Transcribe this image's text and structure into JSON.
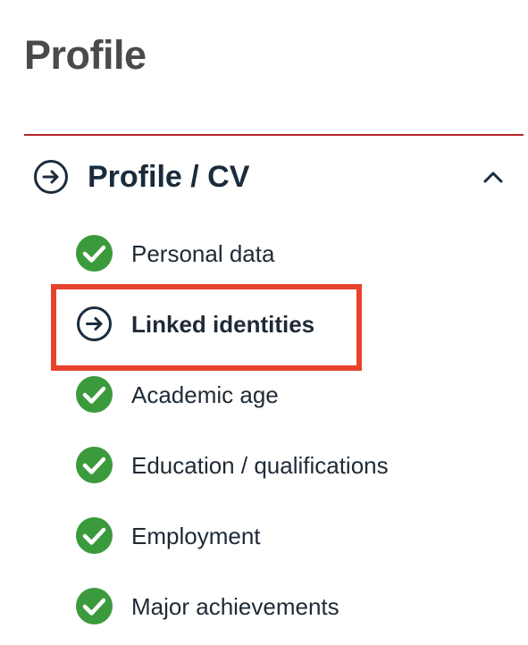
{
  "page": {
    "title": "Profile"
  },
  "section": {
    "title": "Profile / CV",
    "icon": "arrow-right-circle-icon",
    "toggle_icon": "chevron-up-icon",
    "expanded": true
  },
  "items": [
    {
      "label": "Personal data",
      "status": "complete",
      "icon": "check-circle-icon"
    },
    {
      "label": "Linked identities",
      "status": "current",
      "icon": "arrow-right-circle-icon"
    },
    {
      "label": "Academic age",
      "status": "complete",
      "icon": "check-circle-icon"
    },
    {
      "label": "Education / qualifications",
      "status": "complete",
      "icon": "check-circle-icon"
    },
    {
      "label": "Employment",
      "status": "complete",
      "icon": "check-circle-icon"
    },
    {
      "label": "Major achievements",
      "status": "complete",
      "icon": "check-circle-icon"
    }
  ],
  "colors": {
    "title": "#4a4a4a",
    "divider": "#b8262b",
    "text": "#1f2a36",
    "check_green": "#3b9a3b",
    "highlight": "#e8432c"
  }
}
